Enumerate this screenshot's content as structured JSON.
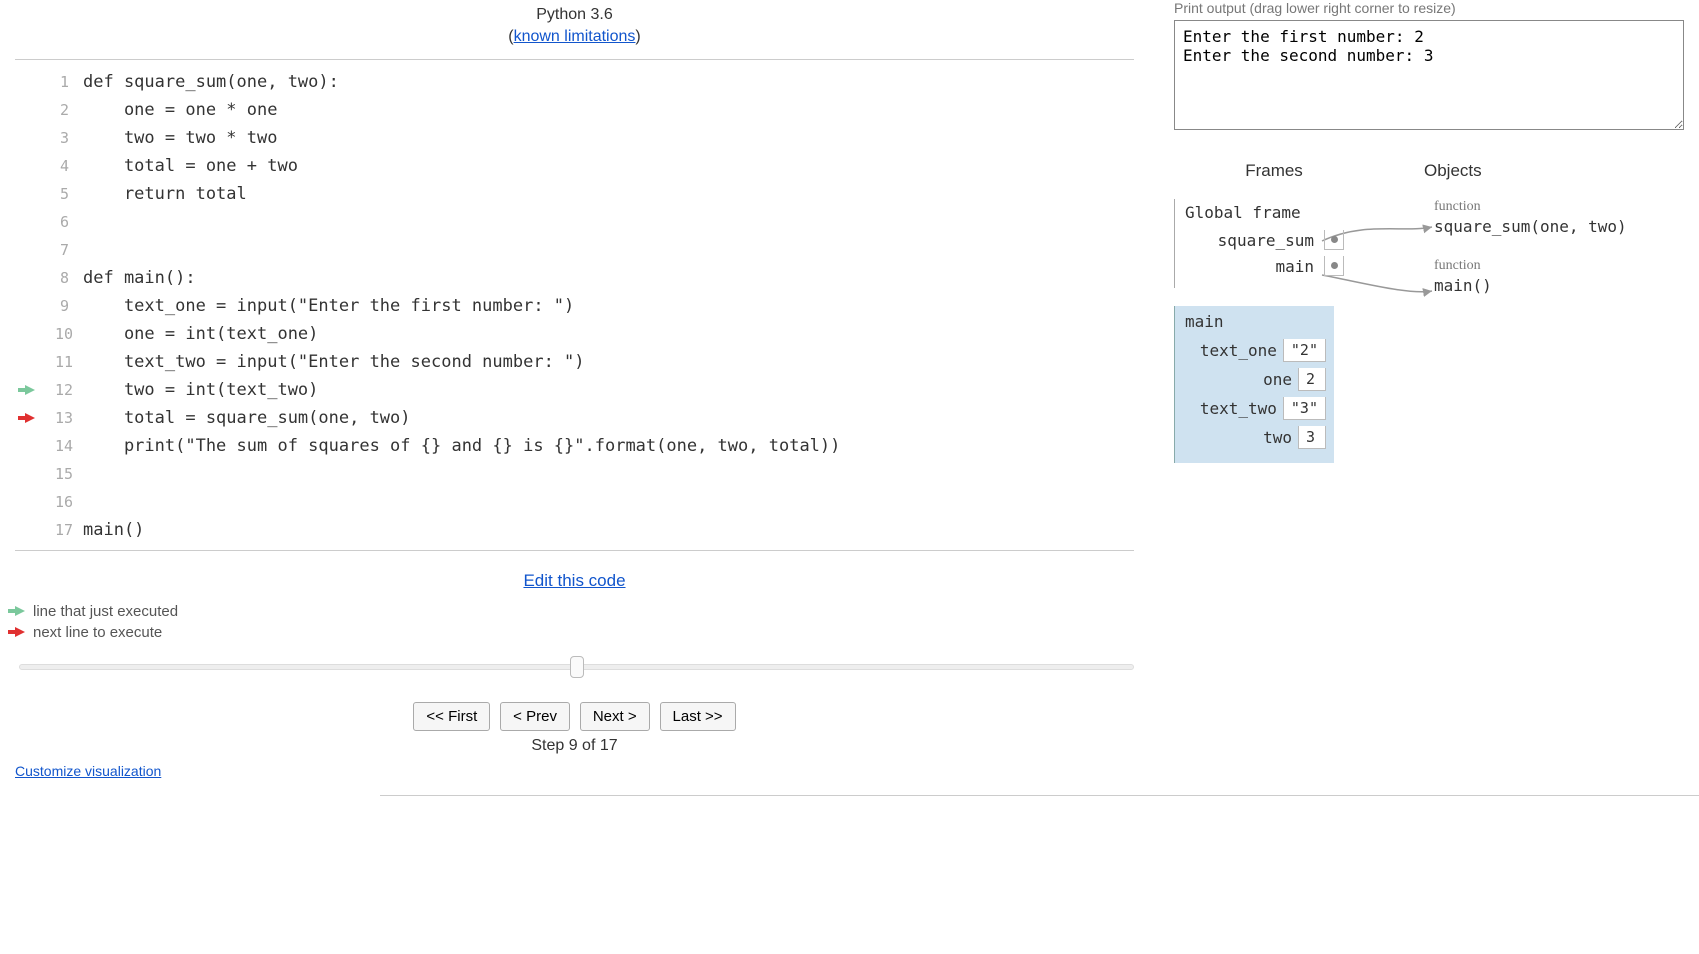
{
  "header": {
    "language": "Python 3.6",
    "limitations_link": "known limitations"
  },
  "code": {
    "just_executed_line": 12,
    "next_line": 13,
    "lines": [
      "def square_sum(one, two):",
      "    one = one * one",
      "    two = two * two",
      "    total = one + two",
      "    return total",
      "",
      "",
      "def main():",
      "    text_one = input(\"Enter the first number: \")",
      "    one = int(text_one)",
      "    text_two = input(\"Enter the second number: \")",
      "    two = int(text_two)",
      "    total = square_sum(one, two)",
      "    print(\"The sum of squares of {} and {} is {}\".format(one, two, total))",
      "",
      "",
      "main()"
    ]
  },
  "edit_link": "Edit this code",
  "legend": {
    "just_executed": "line that just executed",
    "next_line": "next line to execute"
  },
  "controls": {
    "first": "<< First",
    "prev": "< Prev",
    "next": "Next >",
    "last": "Last >>",
    "step_label": "Step 9 of 17",
    "current_step": 9,
    "total_steps": 17
  },
  "customize_link": "Customize visualization",
  "output": {
    "label": "Print output (drag lower right corner to resize)",
    "text": "Enter the first number: 2\nEnter the second number: 3"
  },
  "viz": {
    "frames_header": "Frames",
    "objects_header": "Objects",
    "global_frame_label": "Global frame",
    "global_vars": [
      {
        "name": "square_sum"
      },
      {
        "name": "main"
      }
    ],
    "stack_frame": {
      "name": "main",
      "vars": [
        {
          "name": "text_one",
          "value": "\"2\""
        },
        {
          "name": "one",
          "value": "2"
        },
        {
          "name": "text_two",
          "value": "\"3\""
        },
        {
          "name": "two",
          "value": "3"
        }
      ]
    },
    "objects": [
      {
        "label": "function",
        "repr": "square_sum(one, two)"
      },
      {
        "label": "function",
        "repr": "main()"
      }
    ]
  }
}
